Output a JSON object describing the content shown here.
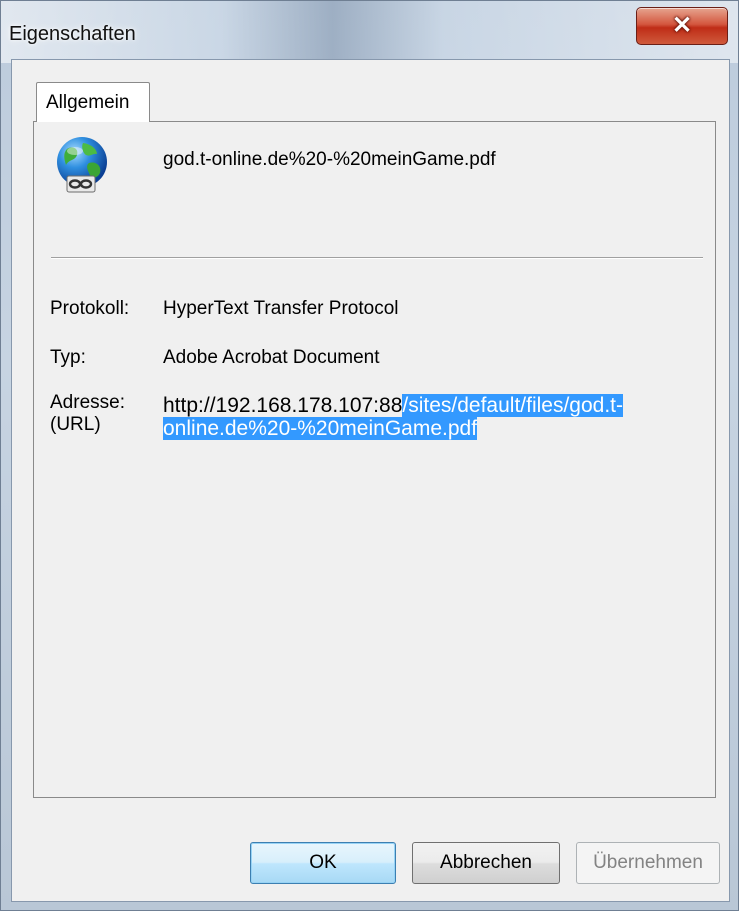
{
  "window": {
    "title": "Eigenschaften",
    "close_icon": "close-icon"
  },
  "tabs": [
    {
      "label": "Allgemein",
      "active": true
    }
  ],
  "file": {
    "icon": "internet-shortcut-globe-icon",
    "name": "god.t-online.de%20-%20meinGame.pdf"
  },
  "properties": {
    "protocol_label": "Protokoll:",
    "protocol_value": "HyperText Transfer Protocol",
    "type_label": "Typ:",
    "type_value": "Adobe Acrobat Document",
    "address_label_line1": "Adresse:",
    "address_label_line2": "(URL)",
    "address_value_unselected": "http://192.168.178.107:88",
    "address_value_selected": "/sites/default/files/god.t-online.de%20-%20meinGame.pdf"
  },
  "buttons": {
    "ok": "OK",
    "cancel": "Abbrechen",
    "apply": "Übernehmen"
  },
  "colors": {
    "selection": "#3399ff",
    "close_button": "#c8331c",
    "disabled_text": "#838383"
  }
}
